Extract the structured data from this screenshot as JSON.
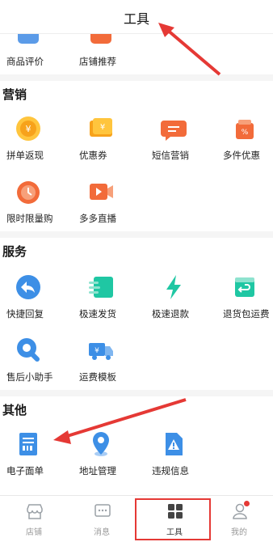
{
  "header": {
    "title": "工具"
  },
  "top_row": [
    {
      "label": "商品评价",
      "icon": "review-icon"
    },
    {
      "label": "店铺推荐",
      "icon": "recommend-icon"
    }
  ],
  "sections": [
    {
      "title": "营销",
      "items": [
        {
          "label": "拼单返现",
          "icon": "cashback-coin-icon"
        },
        {
          "label": "优惠券",
          "icon": "coupon-icon"
        },
        {
          "label": "短信营销",
          "icon": "sms-icon"
        },
        {
          "label": "多件优惠",
          "icon": "gift-discount-icon"
        },
        {
          "label": "限时限量购",
          "icon": "timer-icon"
        },
        {
          "label": "多多直播",
          "icon": "live-icon"
        }
      ]
    },
    {
      "title": "服务",
      "items": [
        {
          "label": "快捷回复",
          "icon": "reply-icon"
        },
        {
          "label": "极速发货",
          "icon": "fast-ship-icon"
        },
        {
          "label": "极速退款",
          "icon": "lightning-icon"
        },
        {
          "label": "退货包运费",
          "icon": "return-box-icon"
        },
        {
          "label": "售后小助手",
          "icon": "wrench-icon"
        },
        {
          "label": "运费模板",
          "icon": "truck-icon"
        }
      ]
    },
    {
      "title": "其他",
      "items": [
        {
          "label": "电子面单",
          "icon": "waybill-icon"
        },
        {
          "label": "地址管理",
          "icon": "location-pin-icon"
        },
        {
          "label": "违规信息",
          "icon": "warning-doc-icon"
        }
      ]
    }
  ],
  "tabbar": [
    {
      "label": "店铺",
      "icon": "store-icon",
      "active": false
    },
    {
      "label": "消息",
      "icon": "message-icon",
      "active": false
    },
    {
      "label": "工具",
      "icon": "grid-icon",
      "active": true
    },
    {
      "label": "我的",
      "icon": "user-icon",
      "active": false,
      "badge": true
    }
  ],
  "colors": {
    "accent_red": "#e53935",
    "orange": "#f5a623",
    "red_orange": "#f26b3a",
    "teal": "#1fc7a3",
    "blue": "#3d8fe6"
  }
}
